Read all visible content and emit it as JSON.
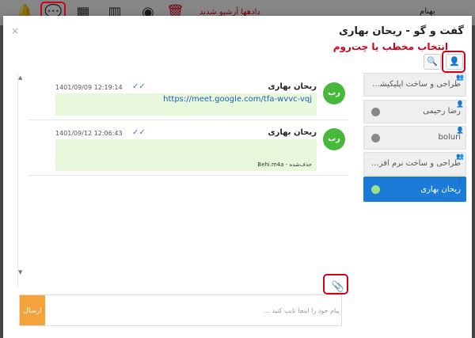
{
  "toolbar": {
    "red_text": "دادهها آرشیو شدند",
    "user_name": "بهنام",
    "icons": {
      "bell": "bell-icon",
      "chat": "chat-bubble-icon",
      "calendar": "calendar-icon",
      "columns": "columns-icon",
      "palette": "palette-icon",
      "trash": "trash-icon"
    }
  },
  "dialog": {
    "title": "گفت و گو - ریحان بهاری",
    "annotation": "انتخاب مخطب یا چت‌روم",
    "close": "×"
  },
  "sidebar": {
    "contacts_button": "👤",
    "search_button": "🔍",
    "items": [
      {
        "label": "طراحی و ساخت اپلیکیشن ...",
        "type": "group",
        "online": false
      },
      {
        "label": "رضا رحیمی",
        "type": "user",
        "online": false
      },
      {
        "label": "boluri",
        "type": "user",
        "online": false
      },
      {
        "label": "طراحی و ساخت نرم افزار و...",
        "type": "group",
        "online": false
      },
      {
        "label": "ریحان بهاری",
        "type": "user",
        "online": true,
        "active": true
      }
    ]
  },
  "messages": [
    {
      "avatar": "رب",
      "sender": "ریحان بهاری",
      "time": "1401/09/09 12:19:14",
      "link": "https://meet.google.com/tfa-wvvc-vqj",
      "note": ""
    },
    {
      "avatar": "رب",
      "sender": "ریحان بهاری",
      "time": "1401/09/12 12:06:43",
      "link": "",
      "note": "Behi.m4a - حذف‌شده"
    }
  ],
  "compose": {
    "placeholder": "پیام خود را اینجا تایپ کنید ...",
    "send_label": "ارسال"
  },
  "colors": {
    "accent": "#1c7bd6",
    "avatar": "#48b83b",
    "bubble": "#e8f8dc",
    "send": "#f5a23a",
    "annotation": "#d0021b"
  }
}
